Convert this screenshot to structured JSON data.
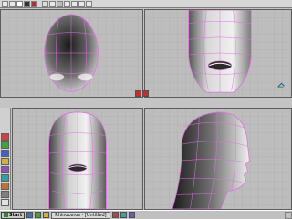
{
  "toolbar": {
    "icons": [
      "new-file-icon",
      "open-icon",
      "save-icon",
      "undo-icon",
      "redo-icon",
      "select-icon",
      "move-icon",
      "rotate-icon",
      "scale-icon",
      "render-icon",
      "wireframe-icon",
      "shaded-icon"
    ]
  },
  "viewports": [
    {
      "name": "top-left-viewport",
      "view": "front-top"
    },
    {
      "name": "top-right-viewport",
      "view": "front-closeup"
    },
    {
      "name": "bottom-left-viewport",
      "view": "front"
    },
    {
      "name": "bottom-right-viewport",
      "view": "side"
    }
  ],
  "colors": {
    "wireframe": "#e070e0",
    "viewport_bg": "#bdbdbd",
    "grid": "#a9a9a9",
    "taskbar": "#c0c0c0"
  },
  "taskbar": {
    "start_label": "Start",
    "items": [
      "Rhinoceros - [Untitled]"
    ],
    "clock": ""
  }
}
